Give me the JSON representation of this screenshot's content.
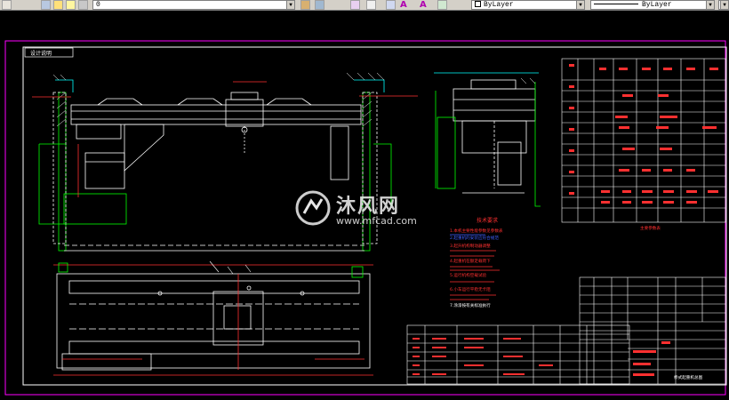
{
  "toolbar": {
    "layer_value": "0",
    "color_value": "ByLayer",
    "linetype_value": "ByLayer",
    "lineweight_value": "ByLayer",
    "text_style_glyphs": [
      "A",
      "A"
    ]
  },
  "drawing": {
    "title_box_label": "设计说明",
    "tech_notes_title": "技术要求",
    "tech_notes": [
      "1.本机主要性能参数见参数表",
      "2.起重机的安装应符合规范",
      "3.起升机构制动器调整",
      "4.起重机在额定载荷下",
      "5.运行机构空载试验",
      "6.小车运行平稳无卡阻",
      "7.涂漆按有关标准执行"
    ],
    "params_title": "主要参数表",
    "title_block_name": "桥式起重机总图"
  },
  "watermark": {
    "cn": "沐风网",
    "en": "www.mfcad.com"
  },
  "colors": {
    "background": "#000000",
    "frame": "#ff00ff",
    "border": "#ffffff",
    "geometry": "#ffffff",
    "hidden": "#00ff00",
    "dim": "#ff0000",
    "accent": "#00ffff",
    "note_text": "#ff3030",
    "note_blue": "#4040ff"
  }
}
